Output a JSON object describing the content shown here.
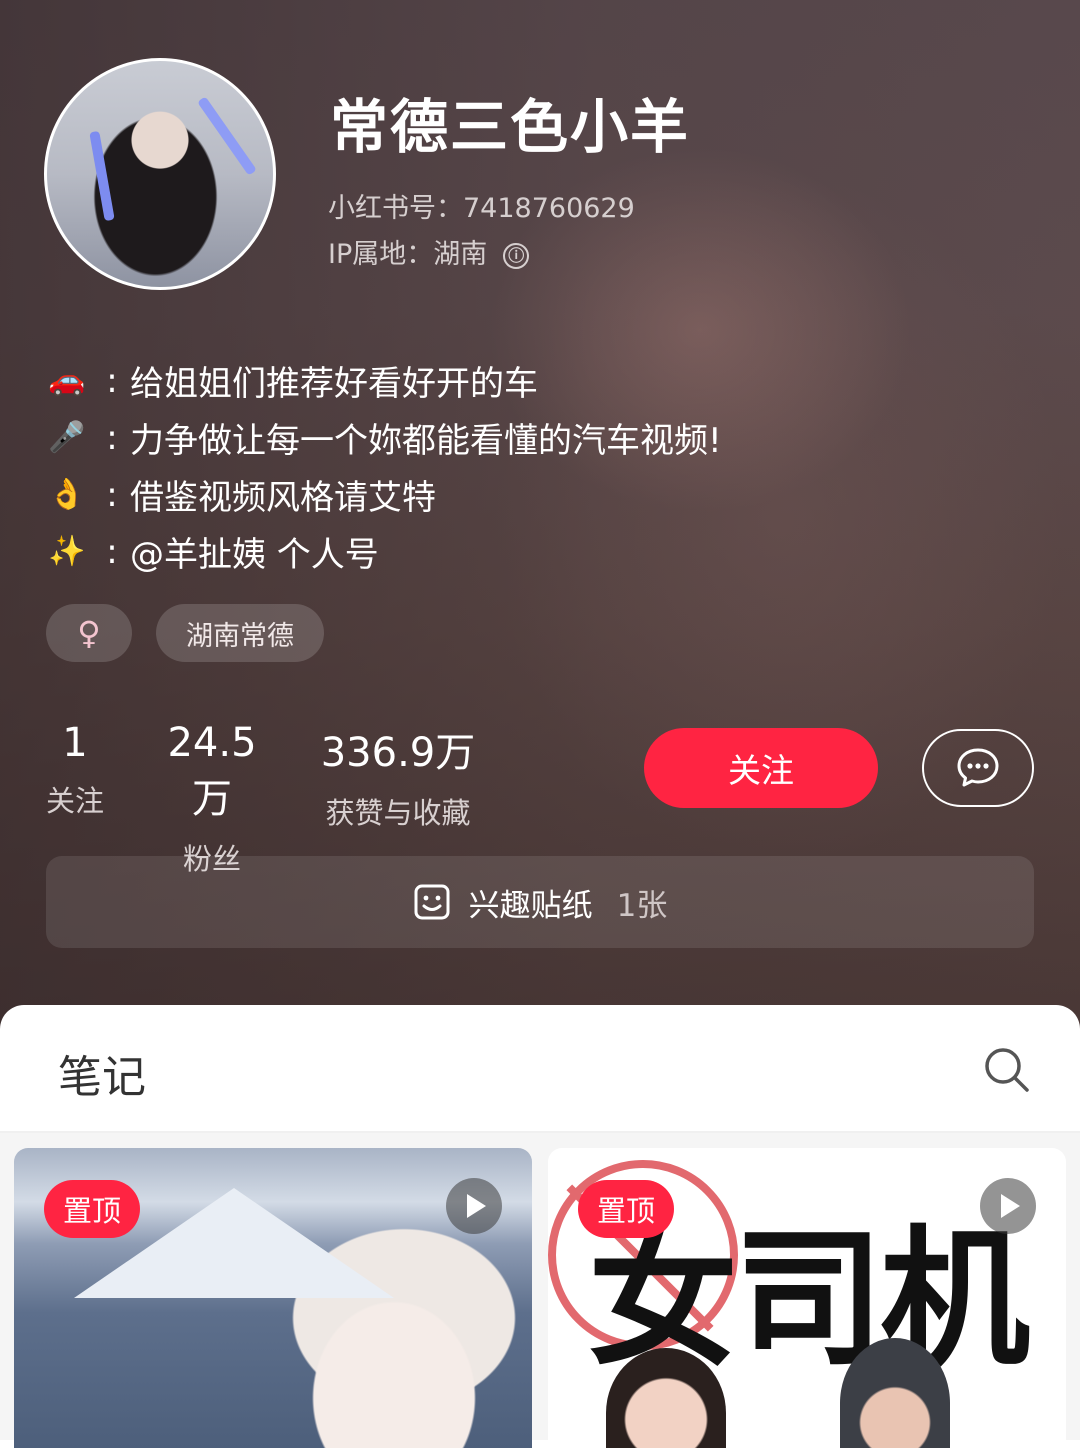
{
  "profile": {
    "nickname": "常德三色小羊",
    "id_text": "小红书号：7418760629",
    "ip_text": "IP属地：湖南",
    "info_icon": "ⓘ"
  },
  "bio": [
    {
      "emoji": "🚗",
      "colon": ":",
      "text": "给姐姐们推荐好看好开的车"
    },
    {
      "emoji": "🎤",
      "colon": ":",
      "text": "力争做让每一个妳都能看懂的汽车视频!"
    },
    {
      "emoji": "👌",
      "colon": ":",
      "text": "借鉴视频风格请艾特"
    },
    {
      "emoji": "✨",
      "colon": ":",
      "text": "@羊扯姨 个人号"
    }
  ],
  "tags": {
    "gender": "♀",
    "location": "湖南常德"
  },
  "stats": [
    {
      "value": "1",
      "label": "关注"
    },
    {
      "value": "24.5万",
      "label": "粉丝"
    },
    {
      "value": "336.9万",
      "label": "获赞与收藏"
    }
  ],
  "actions": {
    "follow_label": "关注",
    "message_icon": "chat-bubble-icon"
  },
  "sticker_bar": {
    "label": "兴趣贴纸",
    "count": "1张"
  },
  "notes": {
    "title": "笔记",
    "cards": [
      {
        "badge": "置顶",
        "is_video": true
      },
      {
        "badge": "置顶",
        "is_video": true,
        "cover_text": "女司机"
      }
    ]
  },
  "colors": {
    "accent": "#ff2442"
  }
}
